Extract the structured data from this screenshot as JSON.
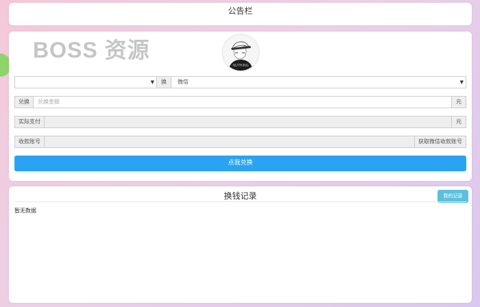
{
  "watermark": "BOSS 资源",
  "announcement": {
    "title": "公告栏"
  },
  "exchange": {
    "method_left_value": "",
    "arrow_label": "换",
    "method_right_value": "微信",
    "amount_label": "兑换",
    "amount_placeholder": "兑换金额",
    "amount_unit": "元",
    "pay_label": "实际支付",
    "pay_value": "",
    "pay_unit": "元",
    "account_label": "收款账号",
    "account_value": "",
    "account_button": "获取微信收款账号",
    "submit_label": "点我兑换"
  },
  "records": {
    "title": "换钱记录",
    "my_records_button": "我的记录",
    "empty_text": "暂无数据"
  },
  "avatar_caption": "NUTHING",
  "icons": {
    "dropdown": "chevron-down-icon"
  },
  "colors": {
    "primary": "#2ba3f2",
    "info": "#5bc0de"
  }
}
